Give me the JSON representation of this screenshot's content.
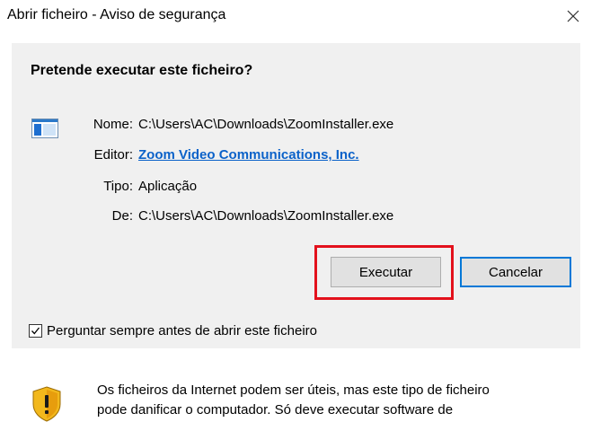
{
  "window": {
    "title": "Abrir ficheiro - Aviso de segurança",
    "close_icon": "close-icon"
  },
  "dialog": {
    "question": "Pretende executar este ficheiro?",
    "app_icon": "application-window-icon",
    "fields": {
      "name_label": "Nome:",
      "name_value": "C:\\Users\\AC\\Downloads\\ZoomInstaller.exe",
      "publisher_label": "Editor:",
      "publisher_value": "Zoom Video Communications, Inc.",
      "type_label": "Tipo:",
      "type_value": "Aplicação",
      "from_label": "De:",
      "from_value": "C:\\Users\\AC\\Downloads\\ZoomInstaller.exe"
    },
    "buttons": {
      "run_label": "Executar",
      "cancel_label": "Cancelar"
    },
    "checkbox": {
      "label": "Perguntar sempre antes de abrir este ficheiro",
      "checked": true
    },
    "warning": {
      "icon": "shield-warning-icon",
      "line1": "Os ficheiros da Internet podem ser úteis, mas este tipo de ficheiro",
      "line2": "pode danificar o computador. Só deve executar software de"
    }
  },
  "colors": {
    "link": "#0b62c9",
    "highlight": "#e3111c",
    "focus_border": "#0078d7",
    "panel_bg": "#f0f0f0"
  }
}
